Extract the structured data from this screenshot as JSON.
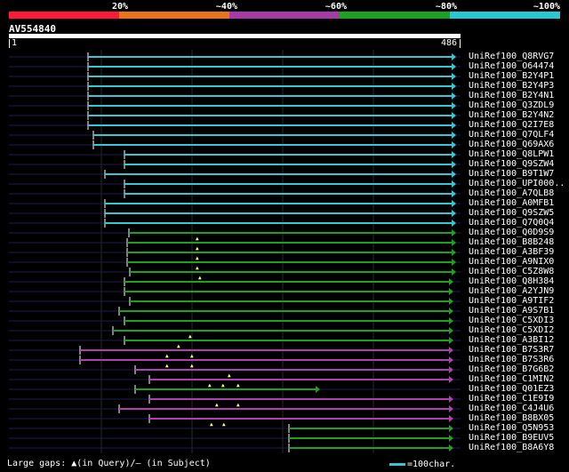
{
  "legend": {
    "labels": [
      "20%",
      "~40%",
      "~60%",
      "~80%",
      "~100%"
    ],
    "colors": [
      "#ff1a3a",
      "#e8731a",
      "#a83aa8",
      "#1ea11e",
      "#28c8d2"
    ]
  },
  "query": {
    "title": "AV554840",
    "start": "1",
    "end": "486"
  },
  "hits": [
    {
      "acc": "UniRef100_Q8RVG7",
      "s": 99,
      "e": 513,
      "c": "cyan"
    },
    {
      "acc": "UniRef100_O64474",
      "s": 99,
      "e": 513,
      "c": "cyan"
    },
    {
      "acc": "UniRef100_B2Y4P1",
      "s": 99,
      "e": 513,
      "c": "cyan"
    },
    {
      "acc": "UniRef100_B2Y4P3",
      "s": 99,
      "e": 513,
      "c": "cyan"
    },
    {
      "acc": "UniRef100_B2Y4N1",
      "s": 99,
      "e": 513,
      "c": "cyan"
    },
    {
      "acc": "UniRef100_Q3ZDL9",
      "s": 99,
      "e": 513,
      "c": "cyan"
    },
    {
      "acc": "UniRef100_B2Y4N2",
      "s": 99,
      "e": 513,
      "c": "cyan"
    },
    {
      "acc": "UniRef100_Q2I7E8",
      "s": 99,
      "e": 513,
      "c": "cyan"
    },
    {
      "acc": "UniRef100_Q7QLF4",
      "s": 105,
      "e": 513,
      "c": "cyan"
    },
    {
      "acc": "UniRef100_Q69AX6",
      "s": 105,
      "e": 513,
      "c": "cyan"
    },
    {
      "acc": "UniRef100_Q8LPW1",
      "s": 140,
      "e": 513,
      "c": "cyan"
    },
    {
      "acc": "UniRef100_Q9SZW4",
      "s": 140,
      "e": 513,
      "c": "cyan"
    },
    {
      "acc": "UniRef100_B9T1W7",
      "s": 118,
      "e": 513,
      "c": "cyan"
    },
    {
      "acc": "UniRef100_UPI000..",
      "s": 140,
      "e": 513,
      "c": "cyan"
    },
    {
      "acc": "UniRef100_A7QLB8",
      "s": 140,
      "e": 513,
      "c": "cyan"
    },
    {
      "acc": "UniRef100_A0MFB1",
      "s": 118,
      "e": 513,
      "c": "cyan"
    },
    {
      "acc": "UniRef100_Q9SZW5",
      "s": 118,
      "e": 513,
      "c": "cyan"
    },
    {
      "acc": "UniRef100_Q7Q0Q4",
      "s": 118,
      "e": 513,
      "c": "cyan"
    },
    {
      "acc": "UniRef100_Q0D9S9",
      "s": 145,
      "e": 513,
      "c": "green"
    },
    {
      "acc": "UniRef100_B8B248",
      "s": 143,
      "e": 513,
      "c": "green"
    },
    {
      "acc": "UniRef100_A3BF39",
      "s": 143,
      "e": 513,
      "c": "green"
    },
    {
      "acc": "UniRef100_A9NIX0",
      "s": 143,
      "e": 513,
      "c": "green"
    },
    {
      "acc": "UniRef100_C5Z8W8",
      "s": 146,
      "e": 513,
      "c": "green"
    },
    {
      "acc": "UniRef100_Q8H384",
      "s": 140,
      "e": 510,
      "c": "green"
    },
    {
      "acc": "UniRef100_A2YJN9",
      "s": 140,
      "e": 510,
      "c": "green"
    },
    {
      "acc": "UniRef100_A9TIF2",
      "s": 146,
      "e": 510,
      "c": "green"
    },
    {
      "acc": "UniRef100_A9S7B1",
      "s": 134,
      "e": 510,
      "c": "green"
    },
    {
      "acc": "UniRef100_C5XDI3",
      "s": 140,
      "e": 510,
      "c": "green"
    },
    {
      "acc": "UniRef100_C5XDI2",
      "s": 127,
      "e": 510,
      "c": "green"
    },
    {
      "acc": "UniRef100_A3BI12",
      "s": 140,
      "e": 510,
      "c": "green"
    },
    {
      "acc": "UniRef100_B7S3R7",
      "s": 90,
      "e": 510,
      "c": "purple"
    },
    {
      "acc": "UniRef100_B7S3R6",
      "s": 90,
      "e": 510,
      "c": "purple"
    },
    {
      "acc": "UniRef100_B7G6B2",
      "s": 152,
      "e": 510,
      "c": "purple"
    },
    {
      "acc": "UniRef100_C1MIN2",
      "s": 168,
      "e": 510,
      "c": "purple"
    },
    {
      "acc": "UniRef100_Q01EZ3",
      "s": 152,
      "e": 360,
      "c": "green"
    },
    {
      "acc": "UniRef100_C1E9I9",
      "s": 168,
      "e": 510,
      "c": "purple"
    },
    {
      "acc": "UniRef100_C4J4U6",
      "s": 134,
      "e": 510,
      "c": "purple"
    },
    {
      "acc": "UniRef100_B8BX05",
      "s": 168,
      "e": 510,
      "c": "purple"
    },
    {
      "acc": "UniRef100_Q5N953",
      "s": 325,
      "e": 510,
      "c": "green"
    },
    {
      "acc": "UniRef100_B9EUV5",
      "s": 325,
      "e": 510,
      "c": "green"
    },
    {
      "acc": "UniRef100_B8A6Y8",
      "s": 325,
      "e": 510,
      "c": "green"
    }
  ],
  "footer": {
    "gaps_text": "Large gaps: ▲(in Query)/– (in Subject)",
    "scale_text": "=100char."
  }
}
